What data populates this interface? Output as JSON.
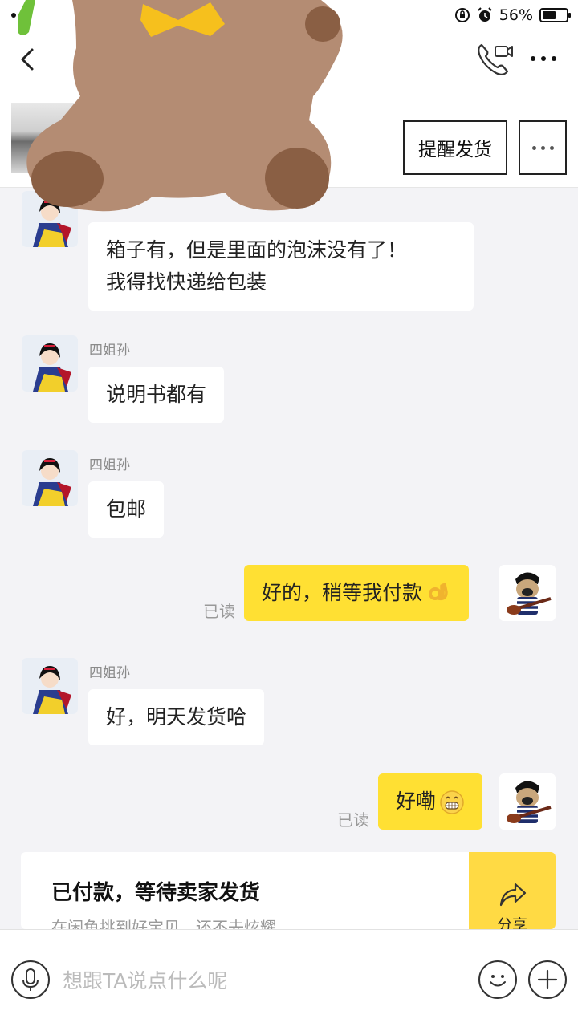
{
  "status_bar": {
    "battery": "56%",
    "battery_level": 0.56
  },
  "nav": {
    "back_icon": "chevron-left-icon",
    "call_icon": "phone-video-icon",
    "more_icon": "more-horizontal-icon"
  },
  "item": {
    "remind_label": "提醒发货",
    "more_icon": "more-horizontal-icon"
  },
  "messages": [
    {
      "side": "in",
      "sender": "",
      "text_line1": "箱子有，但是里面的泡沫没有了！",
      "text_line2": "我得找快递给包装"
    },
    {
      "side": "in",
      "sender": "四姐孙",
      "text": "说明书都有"
    },
    {
      "side": "in",
      "sender": "四姐孙",
      "text": "包邮"
    },
    {
      "side": "out",
      "read": "已读",
      "text": "好的，稍等我付款",
      "emoji": "ok-hand-emoji"
    },
    {
      "side": "in",
      "sender": "四姐孙",
      "text": "好，明天发货哈"
    },
    {
      "side": "out",
      "read": "已读",
      "text": "好嘞",
      "emoji": "grin-emoji"
    }
  ],
  "status_card": {
    "title": "已付款，等待卖家发货",
    "subtitle": "在闲鱼挑到好宝贝，还不去炫耀",
    "share_label": "分享"
  },
  "input_bar": {
    "placeholder": "想跟TA说点什么呢",
    "voice_icon": "microphone-icon",
    "emoji_icon": "smiley-icon",
    "plus_icon": "plus-icon"
  },
  "colors": {
    "accent": "#ffe033",
    "share_bg": "#ffda44",
    "bg": "#f3f3f6"
  }
}
